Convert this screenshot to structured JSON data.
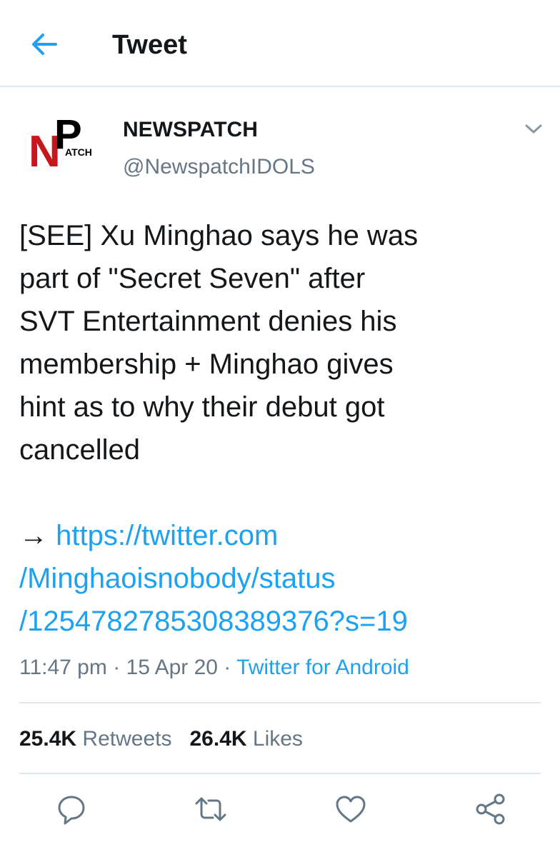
{
  "header": {
    "title": "Tweet",
    "back_icon": "back-arrow-icon"
  },
  "author": {
    "logo_text": {
      "n": "N",
      "p": "P",
      "atch": "ATCH"
    },
    "display_name": "NEWSPATCH",
    "handle": "@NewspatchIDOLS",
    "logo_colors": {
      "primary": "#000000",
      "accent": "#c8161d"
    }
  },
  "tweet": {
    "text": "[SEE] Xu Minghao says he was\npart of \"Secret Seven\" after\nSVT Entertainment denies his\nmembership + Minghao gives\nhint as to why their debut got\ncancelled",
    "arrow": "→ ",
    "link_lines": [
      "https://twitter.com",
      "/Minghaoisnobody/status",
      "/1254782785308389376?s=19"
    ],
    "time": "11:47 pm",
    "date": "15 Apr 20",
    "separator": " · ",
    "source": "Twitter for Android"
  },
  "stats": {
    "retweets_count": "25.4K",
    "retweets_label": "Retweets",
    "likes_count": "26.4K",
    "likes_label": "Likes"
  },
  "actions": [
    "reply-icon",
    "retweet-icon",
    "like-icon",
    "share-icon"
  ],
  "colors": {
    "link": "#1da1f2",
    "secondary_text": "#657786",
    "divider": "#e1e8ed"
  }
}
